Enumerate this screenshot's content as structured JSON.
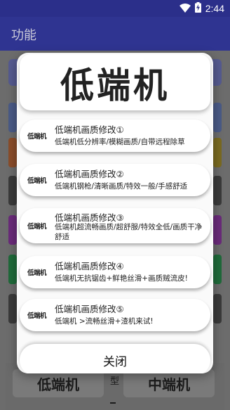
{
  "status_bar": {
    "time": "2:44",
    "icons": [
      "wifi-icon",
      "battery-charging-icon"
    ]
  },
  "app_bar": {
    "title": "功能"
  },
  "dialog": {
    "logo_text": "低端机",
    "items": [
      {
        "icon_text": "低端机",
        "title": "低端机画质修改①",
        "desc": "低端机低分辨率/模糊画质/自带远程除草"
      },
      {
        "icon_text": "低端机",
        "title": "低端机画质修改②",
        "desc": "低端机钢枪/清晰画质/特效一般/手感舒适"
      },
      {
        "icon_text": "低端机",
        "title": "低端机画质修改③",
        "desc": "低端机超流畅画质/超舒服/特效全低/画质干净舒适"
      },
      {
        "icon_text": "低端机",
        "title": "低端机画质修改④",
        "desc": "低端机无抗锯齿+鲜艳丝滑+画质贼流皮!"
      },
      {
        "icon_text": "低端机",
        "title": "低端机画质修改⑤",
        "desc": "低端机 >流畅丝滑+渣机来试!"
      }
    ],
    "close_label": "关闭"
  },
  "background": {
    "bottom_left_label": "低端机",
    "bottom_mid_label": "型",
    "bottom_right_label": "中端机"
  },
  "colors": {
    "status_bar": "#2b2f8a",
    "app_bar": "#2f3491",
    "overlay": "#6c6c6c",
    "dialog": "#fafafa"
  }
}
